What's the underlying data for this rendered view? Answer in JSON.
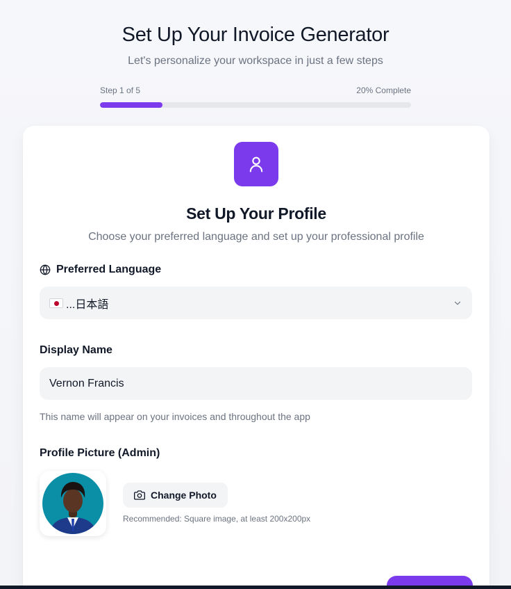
{
  "header": {
    "title": "Set Up Your Invoice Generator",
    "subtitle": "Let's personalize your workspace in just a few steps"
  },
  "progress": {
    "step_text": "Step 1 of 5",
    "percent_text": "20% Complete",
    "fraction": 0.2
  },
  "card": {
    "icon": "user-icon",
    "title": "Set Up Your Profile",
    "subtitle": "Choose your preferred language and set up your professional profile",
    "language": {
      "label": "Preferred Language",
      "label_icon": "globe-icon",
      "selected": "...日本語",
      "flag": "japan-flag-icon"
    },
    "display_name": {
      "label": "Display Name",
      "value": "Vernon Francis",
      "help": "This name will appear on your invoices and throughout the app"
    },
    "profile_picture": {
      "label": "Profile Picture (Admin)",
      "button_label": "Change Photo",
      "button_icon": "camera-icon",
      "recommendation": "Recommended: Square image, at least 200x200px"
    }
  },
  "colors": {
    "accent": "#7c3aed",
    "field_bg": "#f3f4f6",
    "muted_text": "#6b7280"
  }
}
